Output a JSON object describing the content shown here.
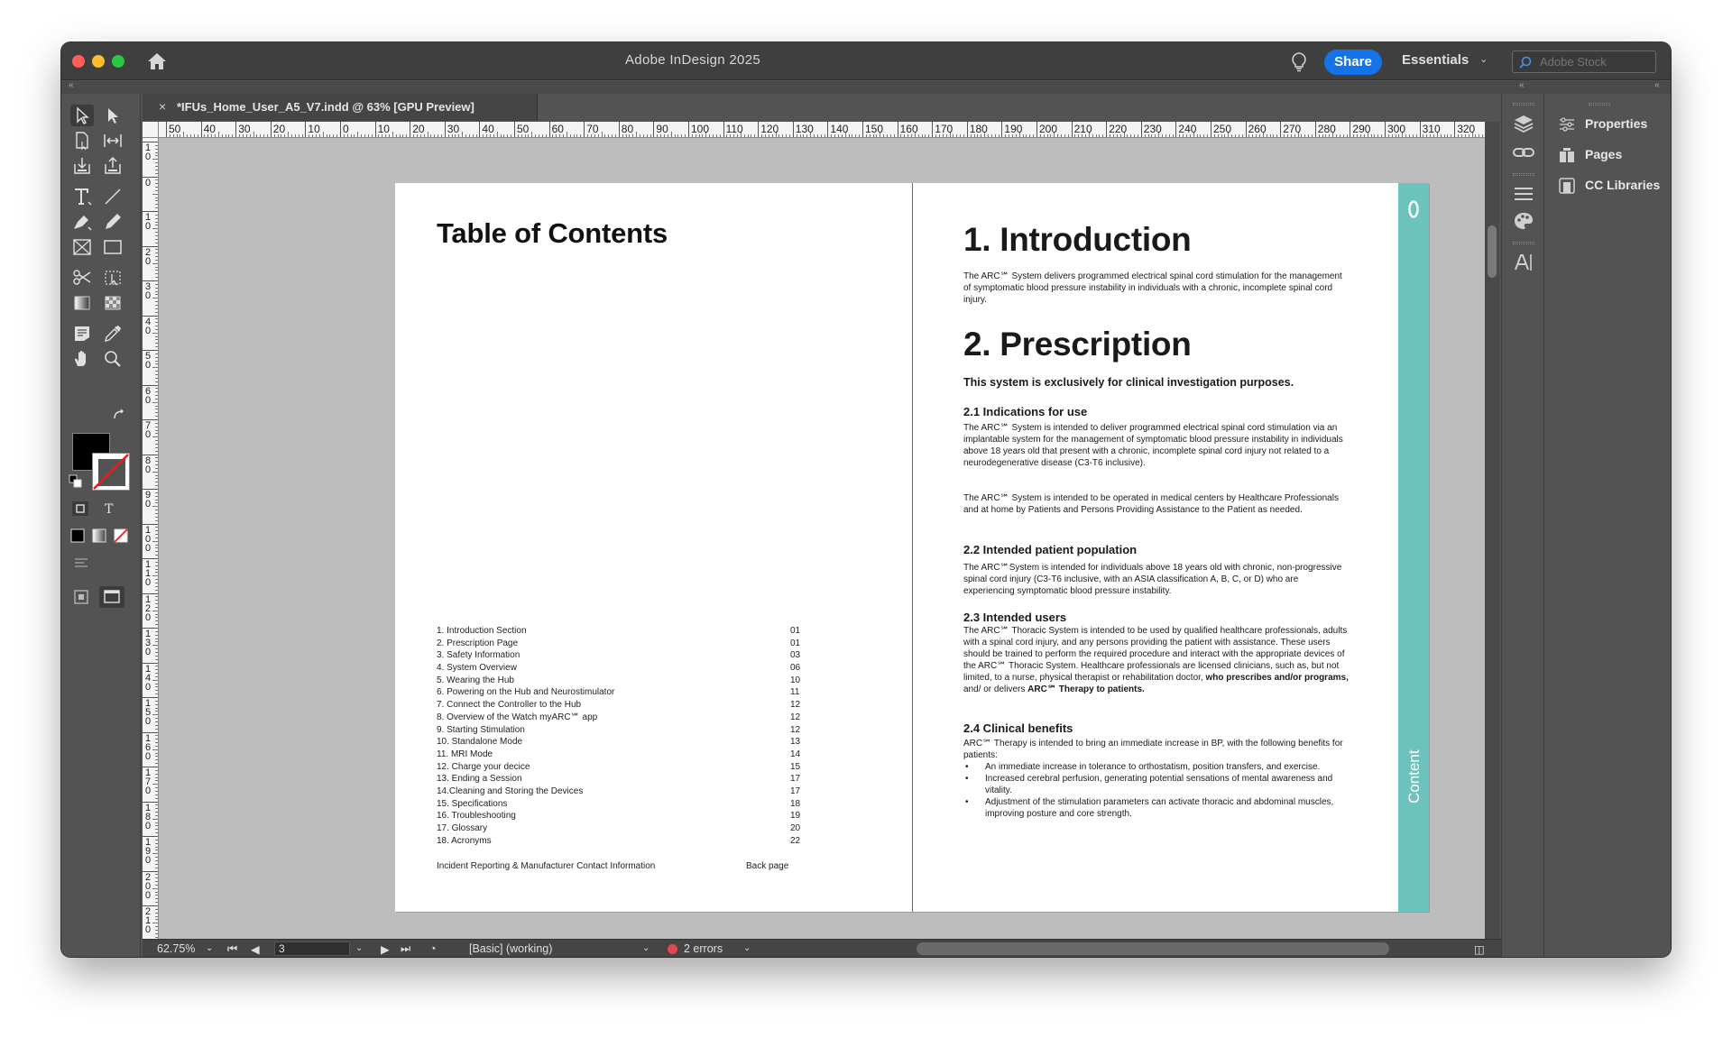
{
  "app": {
    "title": "Adobe InDesign 2025",
    "share_label": "Share",
    "workspace_label": "Essentials",
    "stock_placeholder": "Adobe Stock"
  },
  "document_tab": {
    "close_glyph": "×",
    "label": "*IFUs_Home_User_A5_V7.indd @ 63% [GPU Preview]"
  },
  "rulers": {
    "horizontal": [
      "50",
      "40",
      "30",
      "20",
      "10",
      "0",
      "10",
      "20",
      "30",
      "40",
      "50",
      "60",
      "70",
      "80",
      "90",
      "100",
      "110",
      "120",
      "130",
      "140",
      "150",
      "160",
      "170",
      "180",
      "190",
      "200",
      "210",
      "220",
      "230",
      "240",
      "250",
      "260",
      "270",
      "280",
      "290",
      "300",
      "310",
      "320"
    ],
    "vertical": [
      "1 0",
      "0",
      "1 0",
      "2 0",
      "3 0",
      "4 0",
      "5 0",
      "6 0",
      "7 0",
      "8 0",
      "9 0",
      "1 0 0",
      "1 1 0",
      "1 2 0",
      "1 3 0",
      "1 4 0",
      "1 5 0",
      "1 6 0",
      "1 7 0",
      "1 8 0",
      "1 9 0",
      "2 0 0",
      "2 1 0"
    ]
  },
  "toolbox": {
    "tools": [
      "selection-tool",
      "direct-selection-tool",
      "page-tool",
      "gap-tool",
      "content-collector-tool",
      "content-placer-tool",
      "type-tool",
      "line-tool",
      "pen-tool",
      "pencil-tool",
      "rectangle-frame-tool",
      "rectangle-tool",
      "scissors-tool",
      "free-transform-tool",
      "gradient-swatch-tool",
      "gradient-feather-tool",
      "note-tool",
      "eyedropper-tool",
      "hand-tool",
      "zoom-tool"
    ]
  },
  "left_page": {
    "title": "Table of Contents",
    "toc": [
      {
        "label": "1. Introduction Section",
        "page": "01"
      },
      {
        "label": "2. Prescription Page",
        "page": "01"
      },
      {
        "label": "3. Safety Information",
        "page": "03"
      },
      {
        "label": "4. System Overview",
        "page": "06"
      },
      {
        "label": "5. Wearing the Hub",
        "page": "10"
      },
      {
        "label": "6. Powering on the Hub and Neurostimulator",
        "page": "11"
      },
      {
        "label": "7. Connect the Controller to the Hub",
        "page": "12"
      },
      {
        "label": "8. Overview of the Watch myARC℠ app",
        "page": "12"
      },
      {
        "label": "9. Starting Stimulation",
        "page": "12"
      },
      {
        "label": "10. Standalone Mode",
        "page": "13"
      },
      {
        "label": "11. MRI Mode",
        "page": "14"
      },
      {
        "label": "12. Charge your decice",
        "page": "15"
      },
      {
        "label": "13. Ending a Session",
        "page": "17"
      },
      {
        "label": "14.Cleaning and Storing the Devices",
        "page": "17"
      },
      {
        "label": "15. Specifications",
        "page": "18"
      },
      {
        "label": "16. Troubleshooting",
        "page": "19"
      },
      {
        "label": "17. Glossary",
        "page": "20"
      },
      {
        "label": "18. Acronyms",
        "page": "22"
      }
    ],
    "footer_label": "Incident Reporting & Manufacturer Contact Information",
    "footer_page": "Back page"
  },
  "right_page": {
    "intro_heading": "1. Introduction",
    "intro_body": "The ARC℠ System delivers programmed electrical spinal cord stimulation for the management of symptomatic blood pressure instability in individuals with a chronic, incomplete spinal cord injury.",
    "prescription_heading": "2. Prescription",
    "prescription_lead": "This system is exclusively for clinical investigation purposes.",
    "s21_heading": "2.1 Indications for use",
    "s21_body1": "The ARC℠ System is intended to deliver programmed electrical spinal cord stimulation via an implantable system for the management of symptomatic blood pressure instability in individuals above 18 years old that present with a chronic, incomplete spinal cord injury not related to a neurodegenerative disease (C3-T6 inclusive).",
    "s21_body2": "The ARC℠ System is intended to be operated in medical centers by Healthcare Professionals and at home by Patients and Persons Providing Assistance to the Patient as needed.",
    "s22_heading": "2.2 Intended patient population",
    "s22_body": "The ARC℠System is intended for individuals above 18 years old with chronic, non-progressive spinal cord injury (C3-T6 inclusive, with an ASIA classification A, B, C, or D) who are experiencing symptomatic blood pressure instability.",
    "s23_heading": "2.3 Intended users",
    "s23_body": "The ARC℠ Thoracic System is intended to be used by qualified healthcare professionals, adults with a spinal cord injury, and any persons providing the patient with assistance. These users should be trained to perform the required procedure and interact with the appropriate devices of the ARC℠ Thoracic System. Healthcare professionals are licensed clinicians, such as, but not limited, to a nurse, physical therapist or rehabilitation doctor,",
    "s23_bold1": "who prescribes and/or programs,",
    "s23_mid": "and/ or delivers",
    "s23_bold2": "ARC℠ Therapy to patients.",
    "s24_heading": "2.4 Clinical benefits",
    "s24_body": "ARC℠ Therapy is intended to bring an immediate increase in BP, with the following benefits for patients:",
    "s24_bullets": [
      "An immediate increase in tolerance to orthostatism, position transfers, and exercise.",
      "Increased cerebral perfusion, generating potential sensations of mental awareness and vitality.",
      "Adjustment of the stimulation parameters can activate thoracic and abdominal muscles, improving posture and core strength."
    ],
    "side_tab_label": "Content",
    "teal_color": "#6cc3bd"
  },
  "panels": {
    "items": [
      {
        "label": "Properties",
        "icon": "properties-icon"
      },
      {
        "label": "Pages",
        "icon": "pages-icon"
      },
      {
        "label": "CC Libraries",
        "icon": "cc-libraries-icon"
      }
    ]
  },
  "statusbar": {
    "zoom": "62.75%",
    "page_number": "3",
    "preflight_profile": "[Basic] (working)",
    "errors": "2 errors"
  }
}
